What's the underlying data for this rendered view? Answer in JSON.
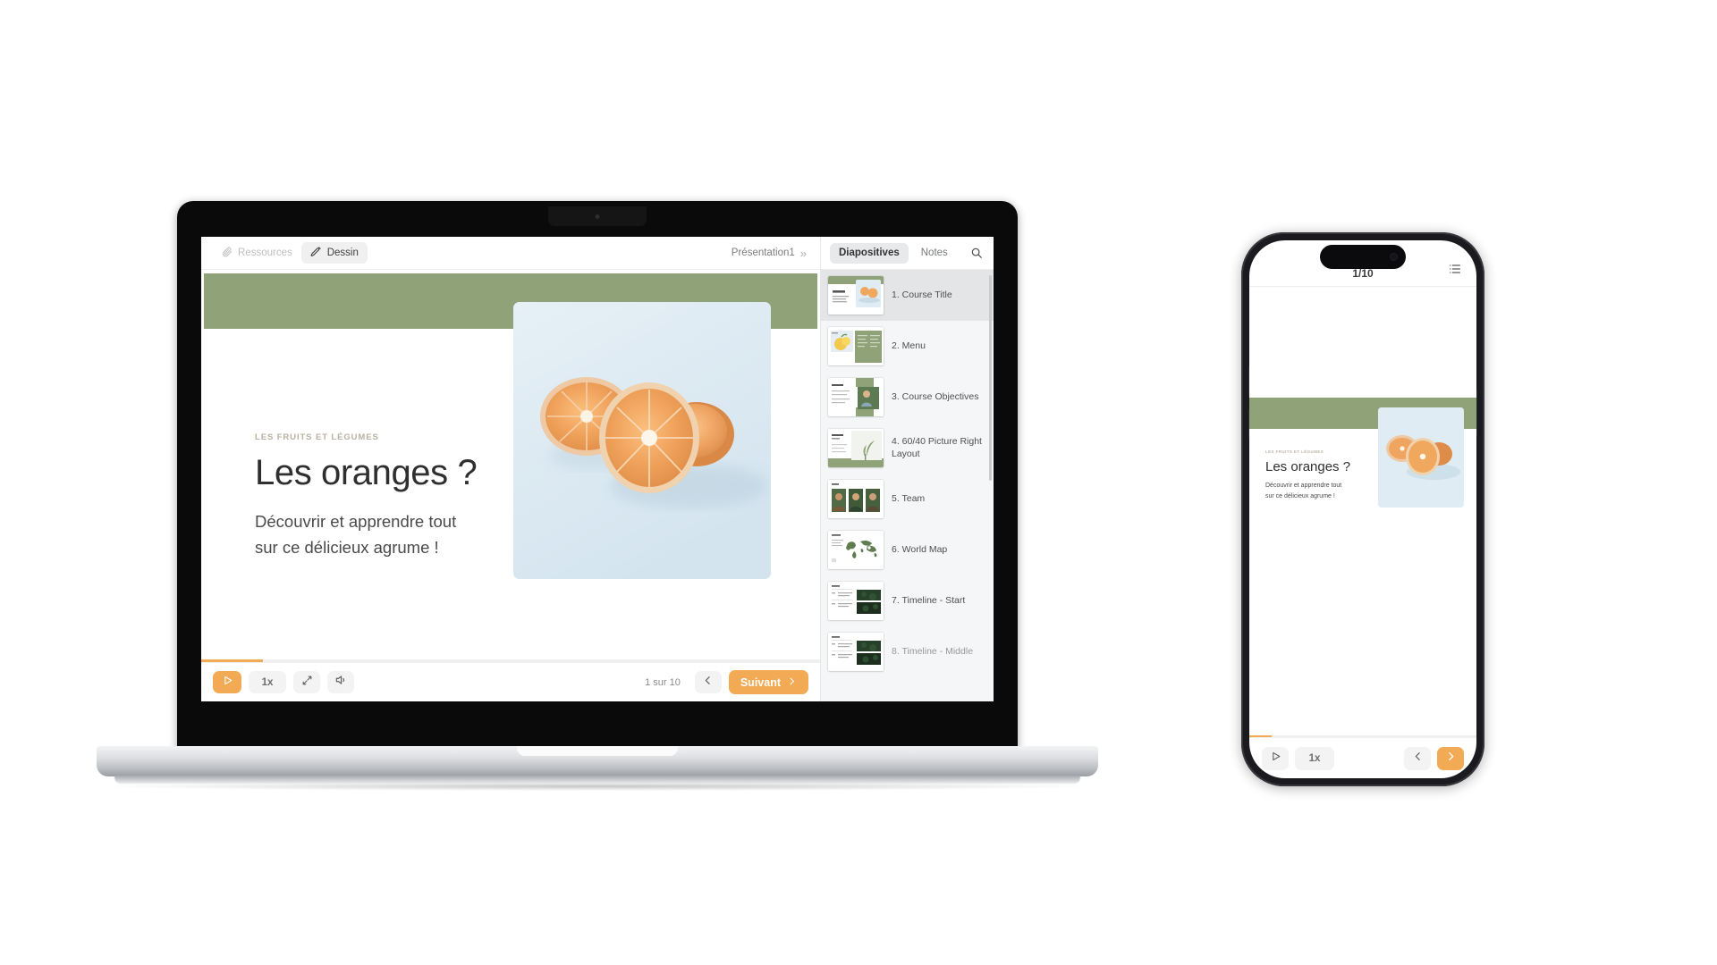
{
  "theme": {
    "green": "#8fa278",
    "orange": "#f3aa55",
    "panel_bg": "#f5f6f7",
    "slide_bg": "#ffffff",
    "photo_bg": "#dce9f2"
  },
  "laptop": {
    "toolbar": {
      "resources_label": "Ressources",
      "draw_label": "Dessin",
      "presentation_title": "Présentation1",
      "expand_glyph": "»"
    },
    "slide": {
      "kicker": "LES FRUITS ET LÉGUMES",
      "title": "Les oranges ?",
      "subtitle": "Découvrir et apprendre tout sur ce délicieux agrume !",
      "subtitle_line1": "Découvrir et apprendre tout",
      "subtitle_line2": "sur ce délicieux agrume !",
      "photo_alt": "orange-halves-photo"
    },
    "controls": {
      "play_label": "play",
      "speed_label": "1x",
      "fullscreen_label": "fullscreen",
      "volume_label": "volume",
      "page_count": "1 sur 10",
      "prev_label": "previous",
      "next_label": "Suivant",
      "next_chevron": "›",
      "progress_percent": 10
    },
    "panel": {
      "tabs": [
        {
          "label": "Diapositives",
          "active": true
        },
        {
          "label": "Notes",
          "active": false
        }
      ],
      "search_label": "search",
      "slides": [
        {
          "num": "1.",
          "label": "1. Course Title",
          "active": true,
          "kind": "title"
        },
        {
          "num": "2.",
          "label": "2. Menu",
          "active": false,
          "kind": "menu"
        },
        {
          "num": "3.",
          "label": "3. Course Objectives",
          "active": false,
          "kind": "objectives"
        },
        {
          "num": "4.",
          "label": "4. 60/40 Picture Right Layout",
          "active": false,
          "kind": "picture6040"
        },
        {
          "num": "5.",
          "label": "5. Team",
          "active": false,
          "kind": "team"
        },
        {
          "num": "6.",
          "label": "6. World Map",
          "active": false,
          "kind": "map"
        },
        {
          "num": "7.",
          "label": "7. Timeline - Start",
          "active": false,
          "kind": "timeline"
        },
        {
          "num": "8.",
          "label": "8. Timeline - Middle",
          "active": false,
          "kind": "timeline"
        }
      ]
    }
  },
  "phone": {
    "header": {
      "page_indicator": "1/10",
      "menu_label": "slides-list"
    },
    "slide": {
      "kicker": "LES FRUITS ET LÉGUMES",
      "title": "Les oranges ?",
      "subtitle_line1": "Découvrir et apprendre tout",
      "subtitle_line2": "sur ce délicieux agrume !"
    },
    "controls": {
      "play_label": "play",
      "speed_label": "1x",
      "prev_label": "previous",
      "next_label": "next",
      "progress_percent": 10
    }
  }
}
